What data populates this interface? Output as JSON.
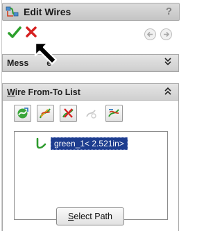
{
  "window": {
    "title": "Edit Wires",
    "help_label": "?"
  },
  "actions": {
    "ok_icon": "green-check-icon",
    "cancel_icon": "red-x-icon",
    "back_icon": "back-arrow-icon",
    "forward_icon": "forward-arrow-icon"
  },
  "message_group": {
    "label_first": "Mess",
    "label_last": "e",
    "chevron": "»"
  },
  "wire_group": {
    "label_underlined": "W",
    "label_rest": "ire From-To List",
    "chevron": "»",
    "toolbar_icons": [
      "add-wire-icon",
      "edit-wire-icon",
      "delete-wire-icon",
      "disabled-wire-icon",
      "reorder-wire-icon"
    ],
    "items": [
      {
        "label": "green_1< 2.521in>",
        "icon": "wire-icon",
        "color": "#2e9b2e"
      }
    ]
  },
  "select_path": {
    "label_underlined": "S",
    "label_rest": "elect Path"
  },
  "colors": {
    "selection": "#1d3d8f",
    "ok_green": "#2ca02c",
    "cancel_red": "#d62020"
  }
}
